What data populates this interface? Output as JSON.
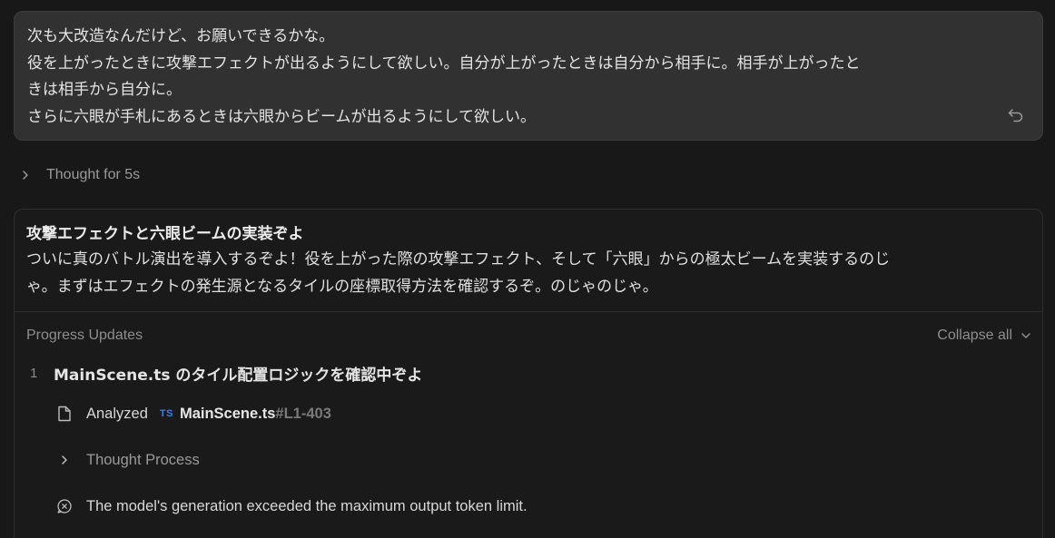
{
  "user_message": {
    "lines": [
      "次も大改造なんだけど、お願いできるかな。",
      "役を上がったときに攻撃エフェクトが出るようにして欲しい。自分が上がったときは自分から相手に。相手が上がったと",
      "きは相手から自分に。",
      "さらに六眼が手札にあるときは六眼からビームが出るようにして欲しい。"
    ],
    "undo_icon": "undo-icon"
  },
  "thought": {
    "label": "Thought for 5s"
  },
  "response": {
    "title": "攻撃エフェクトと六眼ビームの実装ぞよ",
    "body_lines": [
      "ついに真のバトル演出を導入するぞよ！役を上がった際の攻撃エフェクト、そして「六眼」からの極太ビームを実装するのじ",
      "ゃ。まずはエフェクトの発生源となるタイルの座標取得方法を確認するぞ。のじゃのじゃ。"
    ],
    "progress": {
      "title": "Progress Updates",
      "collapse_label": "Collapse all",
      "steps": [
        {
          "number": "1",
          "title": "MainScene.ts のタイル配置ロジックを確認中ぞよ",
          "items": [
            {
              "type": "analyzed",
              "icon": "file-icon",
              "label": "Analyzed",
              "badge": "TS",
              "file": "MainScene.ts",
              "range": "#L1-403"
            },
            {
              "type": "thought",
              "icon": "chevron-right-icon",
              "label": "Thought Process"
            },
            {
              "type": "error",
              "icon": "error-icon",
              "label": "The model's generation exceeded the maximum output token limit."
            }
          ]
        }
      ]
    }
  }
}
